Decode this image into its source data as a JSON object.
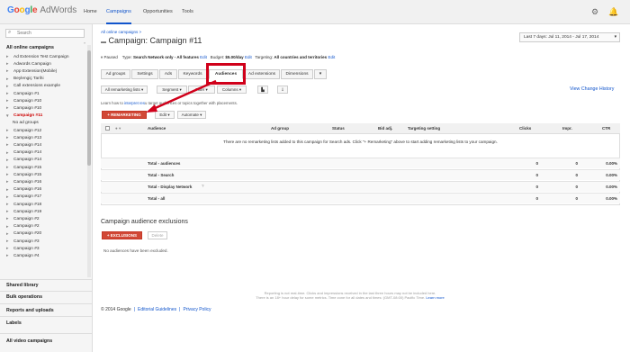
{
  "header": {
    "logo_google": "Google",
    "logo_product": "AdWords",
    "nav": [
      "Home",
      "Campaigns",
      "Opportunities",
      "Tools"
    ],
    "active_nav": "Campaigns",
    "icons": [
      "gear-icon",
      "bell-icon"
    ]
  },
  "sidebar": {
    "search_placeholder": "Search",
    "section_title": "All online campaigns",
    "campaigns": [
      "Ad Extension Test Campaign",
      "Adwords Campaign",
      "App Extension(Mobile)",
      "Beylengiç Tarihi",
      "Call extensions example",
      "Campaign #1",
      "Campaign #10",
      "Campaign #10",
      "Campaign #11",
      "No ad groups",
      "Campaign #12",
      "Campaign #13",
      "Campaign #14",
      "Campaign #14",
      "Campaign #14",
      "Campaign #15",
      "Campaign #15",
      "Campaign #16",
      "Campaign #16",
      "Campaign #17",
      "Campaign #18",
      "Campaign #19",
      "Campaign #2",
      "Campaign #2",
      "Campaign #20",
      "Campaign #3",
      "Campaign #3",
      "Campaign #4"
    ],
    "selected": "Campaign #11",
    "bottom_links": [
      "Shared library",
      "Bulk operations",
      "Reports and uploads",
      "Labels",
      "All video campaigns"
    ]
  },
  "main": {
    "breadcrumb": "All online campaigns >",
    "title": "Campaign: Campaign #11",
    "date_range": "Last 7 days: Jul 11, 2014 - Jul 17, 2014",
    "status": {
      "state": "Paused",
      "type_label": "Type:",
      "type_value": "Search Network only - All features",
      "edit": "Edit",
      "budget_label": "Budget:",
      "budget_value": "$5.00/day",
      "targeting_label": "Targeting:",
      "targeting_value": "All countries and territories"
    },
    "tabs": [
      "Ad groups",
      "Settings",
      "Ads",
      "Keywords",
      "Audiences",
      "Ad extensions",
      "Dimensions",
      "▾"
    ],
    "active_tab": "Audiences",
    "toolbar": {
      "filter": "All remarketing lists",
      "segment": "Segment",
      "filter2": "Filter",
      "columns": "Columns",
      "view_change_history": "View Change History"
    },
    "hint_prefix": "Learn how to",
    "hint_link": "interpret res",
    "hint_suffix": "u target audiences or topics together with placements.",
    "actions": {
      "remarketing": "+ REMARKETING",
      "edit": "Edit",
      "automate": "Automate"
    },
    "table": {
      "columns": [
        "Audience",
        "Ad group",
        "Status",
        "Bid adj.",
        "Targeting setting",
        "Clicks",
        "Impr.",
        "CTR"
      ],
      "empty_message": "There are no remarketing lists added to this campaign for Search ads. Click \"+ Remarketing\" above to start adding remarketing lists to your campaign.",
      "totals": [
        {
          "label": "Total - audiences",
          "clicks": "0",
          "impr": "0",
          "ctr": "0.00%"
        },
        {
          "label": "Total - Search",
          "clicks": "0",
          "impr": "0",
          "ctr": "0.00%"
        },
        {
          "label": "Total - Display Network",
          "clicks": "0",
          "impr": "0",
          "ctr": "0.00%"
        },
        {
          "label": "Total - all",
          "clicks": "0",
          "impr": "0",
          "ctr": "0.00%"
        }
      ]
    },
    "exclusions": {
      "title": "Campaign audience exclusions",
      "button": "+ EXCLUSIONS",
      "delete": "Delete",
      "empty": "No audiences have been excluded."
    }
  },
  "footer": {
    "note_line1": "Reporting is not real-time. Clicks and impressions received in the last three hours may not be included here.",
    "note_line2": "There is an 18+ hour delay for some metrics. Time zone for all dates and times: (GMT-08:00) Pacific Time.",
    "note_link": "Learn more",
    "copyright": "© 2014 Google",
    "links": [
      "Editorial Guidelines",
      "Privacy Policy"
    ]
  },
  "colors": {
    "accent": "#1155cc",
    "remarketing_button": "#d14836",
    "highlight": "#d0001a"
  }
}
